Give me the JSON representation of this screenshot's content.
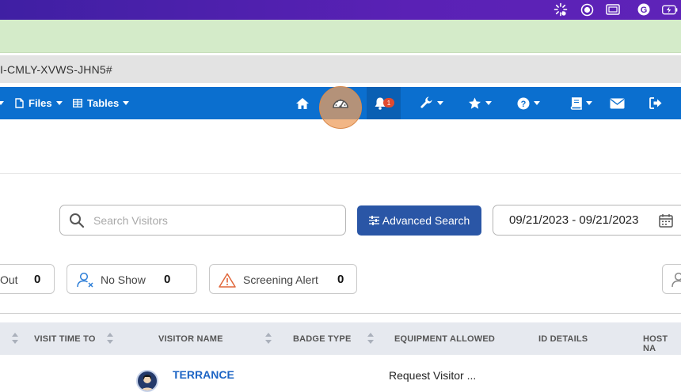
{
  "url": {
    "text": "I-CMLY-XVWS-JHN5#"
  },
  "nav": {
    "files_label": "Files",
    "tables_label": "Tables",
    "notification_count": "1"
  },
  "search": {
    "placeholder": "Search Visitors"
  },
  "advanced_search": {
    "label": "Advanced Search"
  },
  "date_range": {
    "value": "09/21/2023 - 09/21/2023"
  },
  "stats": {
    "out": {
      "label": "Out",
      "count": "0"
    },
    "no_show": {
      "label": "No Show",
      "count": "0"
    },
    "screening_alert": {
      "label": "Screening Alert",
      "count": "0"
    }
  },
  "table": {
    "headers": {
      "visit_time_to": "VISIT TIME TO",
      "visitor_name": "VISITOR NAME",
      "badge_type": "BADGE TYPE",
      "equipment_allowed": "EQUIPMENT ALLOWED",
      "id_details": "ID DETAILS",
      "host_name": "HOST NA"
    },
    "rows": [
      {
        "visitor_name": "TERRANCE",
        "equipment": "Request Visitor ..."
      }
    ]
  },
  "colors": {
    "nav": "#0b6fcf",
    "primary_button": "#2a56a6",
    "link": "#1c64c4",
    "status_band": "#d4ebc9"
  }
}
